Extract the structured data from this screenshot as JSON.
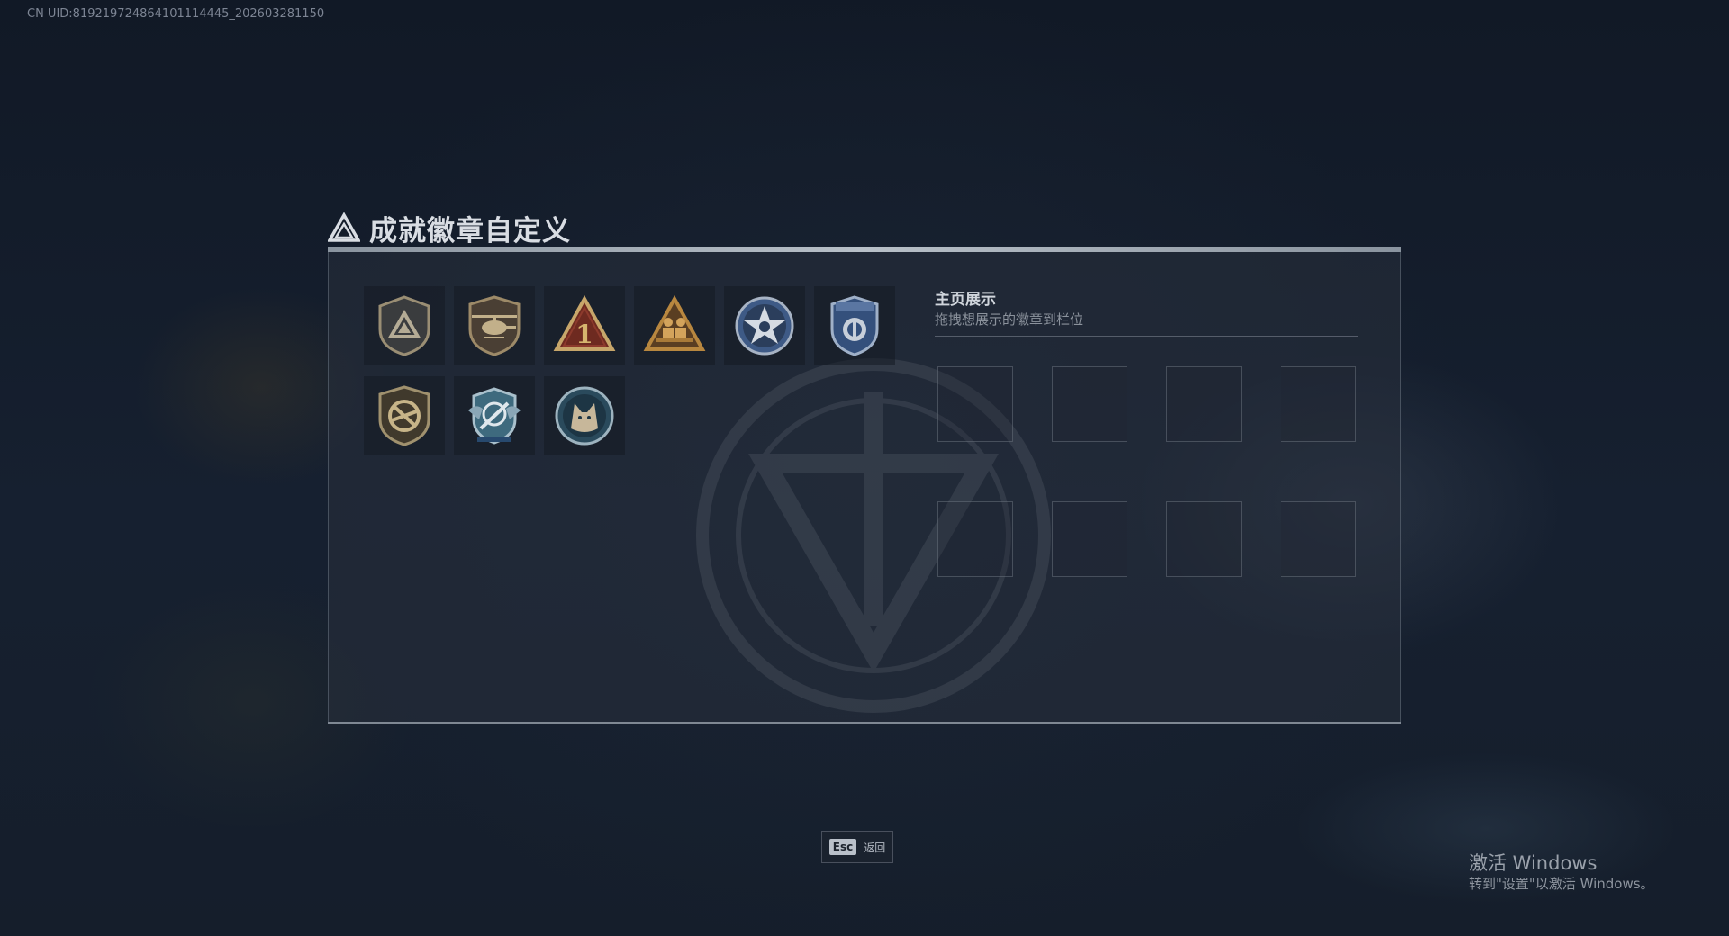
{
  "meta": {
    "uid_text": "CN UID:819219724864101114445_202603281150"
  },
  "header": {
    "title": "成就徽章自定义",
    "logo_icon": "delta-triangle-logo-icon"
  },
  "badges": [
    {
      "icon": "shield-triangle-badge-icon"
    },
    {
      "icon": "helicopter-shield-badge-icon"
    },
    {
      "icon": "number-one-triangle-badge-icon"
    },
    {
      "icon": "soldiers-triangle-badge-icon"
    },
    {
      "icon": "star-skull-round-badge-icon"
    },
    {
      "icon": "police-shield-badge-icon"
    },
    {
      "icon": "no-rifle-shield-badge-icon"
    },
    {
      "icon": "sniper-winged-badge-icon"
    },
    {
      "icon": "wolf-round-badge-icon"
    }
  ],
  "showcase": {
    "title": "主页展示",
    "subtitle": "拖拽想展示的徽章到栏位",
    "slot_count": 8
  },
  "footer": {
    "esc_key": "Esc",
    "esc_label": "返回"
  },
  "windows_activation": {
    "title": "激活 Windows",
    "subtitle": "转到\"设置\"以激活 Windows。"
  },
  "colors": {
    "background": "#0f1622",
    "panel": "#28303c",
    "badge_gold": "#c7a66a",
    "badge_bronze": "#9a7a4a",
    "badge_red": "#7a2e22",
    "badge_blue": "#3e5a86"
  }
}
